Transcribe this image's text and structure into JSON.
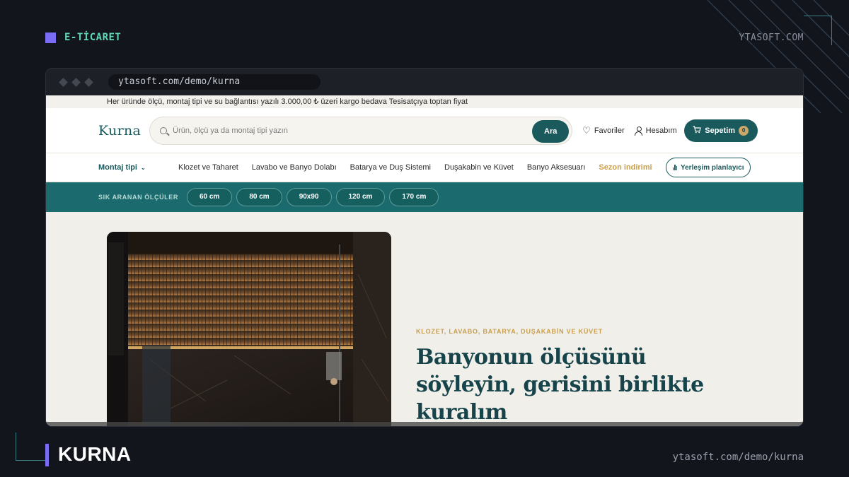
{
  "frame": {
    "category": "E-TİCARET",
    "brand": "YTASOFT.COM",
    "project_title": "KURNA",
    "project_url": "ytasoft.com/demo/kurna"
  },
  "browser": {
    "address": "ytasoft.com/demo/kurna"
  },
  "announcement": "Her üründe ölçü, montaj tipi ve su bağlantısı yazılı 3.000,00 ₺ üzeri kargo bedava Tesisatçıya toptan fiyat",
  "header": {
    "logo": "Kurna",
    "search_placeholder": "Ürün, ölçü ya da montaj tipi yazın",
    "search_button": "Ara",
    "favorites": "Favoriler",
    "account": "Hesabım",
    "cart_label": "Sepetim",
    "cart_count": "0"
  },
  "nav": {
    "mount_type": "Montaj tipi",
    "items": [
      "Klozet ve Taharet",
      "Lavabo ve Banyo Dolabı",
      "Batarya ve Duş Sistemi",
      "Duşakabin ve Küvet",
      "Banyo Aksesuarı"
    ],
    "sale": "Sezon indirimi",
    "planner": "Yerleşim planlayıcı"
  },
  "sizes": {
    "label": "SIK ARANAN ÖLÇÜLER",
    "options": [
      "60 cm",
      "80 cm",
      "90x90",
      "120 cm",
      "170 cm"
    ]
  },
  "hero": {
    "kicker": "KLOZET, LAVABO, BATARYA, DUŞAKABİN VE KÜVET",
    "headline": "Banyonun ölçüsünü söyleyin, gerisini birlikte kuralım"
  },
  "colors": {
    "accent": "#1a5a5c",
    "teal_band": "#1a6a6e",
    "gold": "#c99f4e",
    "frame_purple": "#7b6cf6",
    "frame_green": "#5fd7b5"
  }
}
